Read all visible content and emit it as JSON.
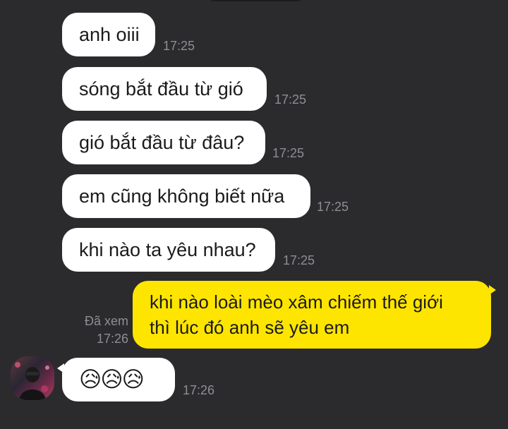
{
  "messages_in": [
    {
      "text": "anh oiii",
      "time": "17:25"
    },
    {
      "text": "sóng bắt đầu từ gió",
      "time": "17:25"
    },
    {
      "text": "gió bắt đầu từ đâu?",
      "time": "17:25"
    },
    {
      "text": "em cũng không biết nữa",
      "time": "17:25"
    },
    {
      "text": "khi nào ta yêu nhau?",
      "time": "17:25"
    }
  ],
  "message_out": {
    "lines": [
      "khi nào loài mèo xâm chiếm thế giới",
      "thì lúc đó anh sẽ yêu em"
    ],
    "read_label": "Đã xem",
    "time": "17:26"
  },
  "reply": {
    "emoji": "😥😥😥",
    "time": "17:26"
  },
  "colors": {
    "background": "#2b2b2e",
    "incoming_bubble": "#ffffff",
    "outgoing_bubble": "#fee500",
    "timestamp": "#8e8e93"
  }
}
